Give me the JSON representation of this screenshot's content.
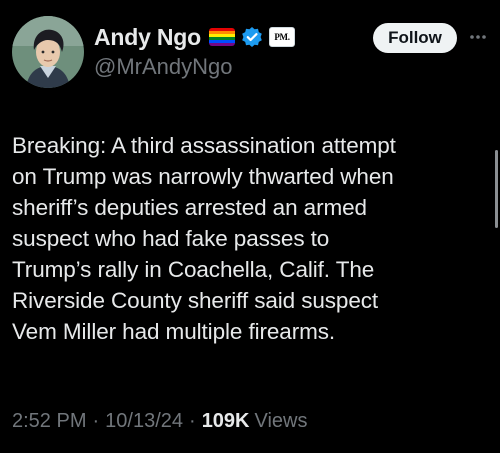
{
  "author": {
    "display_name": "Andy Ngo",
    "handle": "@MrAndyNgo",
    "flag_icon": "rainbow-flag-emoji",
    "verified_icon": "verified-badge-icon",
    "affiliate_badge": "PM.",
    "colors": {
      "verified": "#1d9bf0",
      "flag": [
        "#e40303",
        "#ff8c00",
        "#ffed00",
        "#008026",
        "#004dff",
        "#750787"
      ]
    }
  },
  "actions": {
    "follow_label": "Follow",
    "more_icon": "more-dots-icon"
  },
  "tweet": {
    "lines": [
      "Breaking: A third assassination attempt",
      "on Trump was narrowly thwarted when",
      "sheriff’s deputies arrested an armed",
      "suspect who had fake passes to",
      "Trump’s rally in Coachella, Calif. The",
      "Riverside County sheriff said suspect",
      "Vem Miller had multiple firearms."
    ]
  },
  "meta": {
    "time": "2:52 PM",
    "separator": "·",
    "date": "10/13/24",
    "views_count": "109K",
    "views_label": "Views"
  },
  "theme": {
    "background": "#000000",
    "text_primary": "#e7e9ea",
    "text_secondary": "#71767b"
  }
}
